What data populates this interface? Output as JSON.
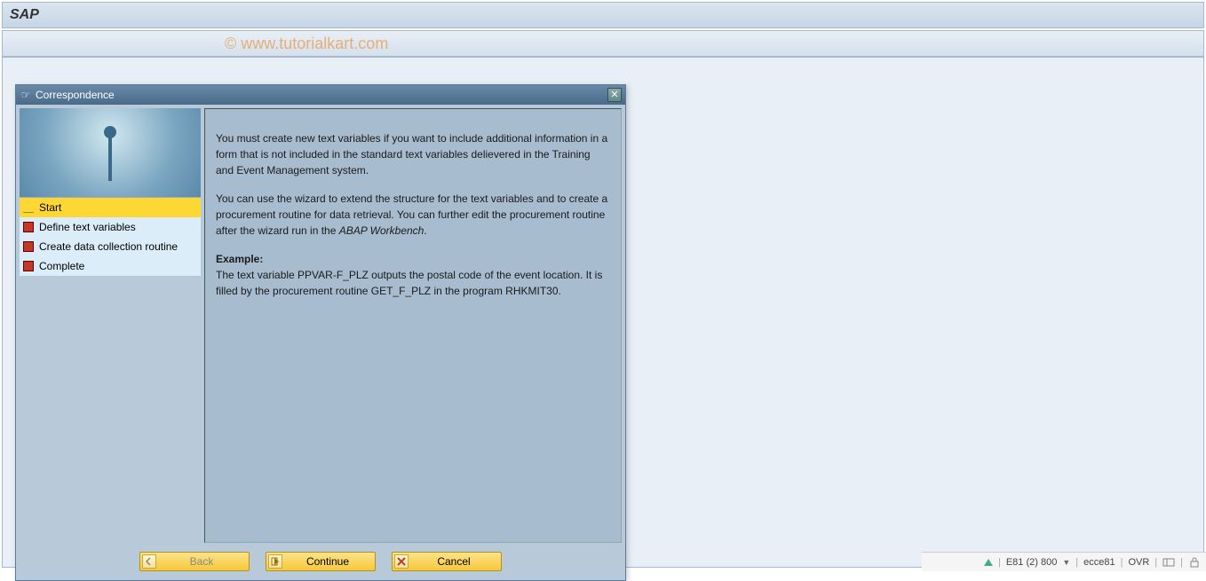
{
  "title": "SAP",
  "watermark": "© www.tutorialkart.com",
  "dialog": {
    "title": "Correspondence",
    "steps": [
      {
        "label": "Start",
        "active": true,
        "icon": "triangle"
      },
      {
        "label": "Define text variables",
        "active": false,
        "icon": "square"
      },
      {
        "label": "Create data collection routine",
        "active": false,
        "icon": "square"
      },
      {
        "label": "Complete",
        "active": false,
        "icon": "square"
      }
    ],
    "content": {
      "p1": "You must create new text variables if you want to include additional information in a form that is not included in the standard text variables delievered in the Training and Event Management system.",
      "p2a": "You can use the wizard to extend the structure for the text variables and to create a procurement routine for data retrieval. You can further edit the procurement routine after the wizard run in the ",
      "p2b": "ABAP Workbench",
      "p2c": ".",
      "example_label": "Example:",
      "example_text": "The text variable PPVAR-F_PLZ outputs the postal code of the event location. It is filled by the procurement routine GET_F_PLZ in the program RHKMIT30."
    },
    "buttons": {
      "back": "Back",
      "continue": "Continue",
      "cancel": "Cancel"
    }
  },
  "statusbar": {
    "system": "E81 (2) 800",
    "server": "ecce81",
    "mode": "OVR"
  }
}
